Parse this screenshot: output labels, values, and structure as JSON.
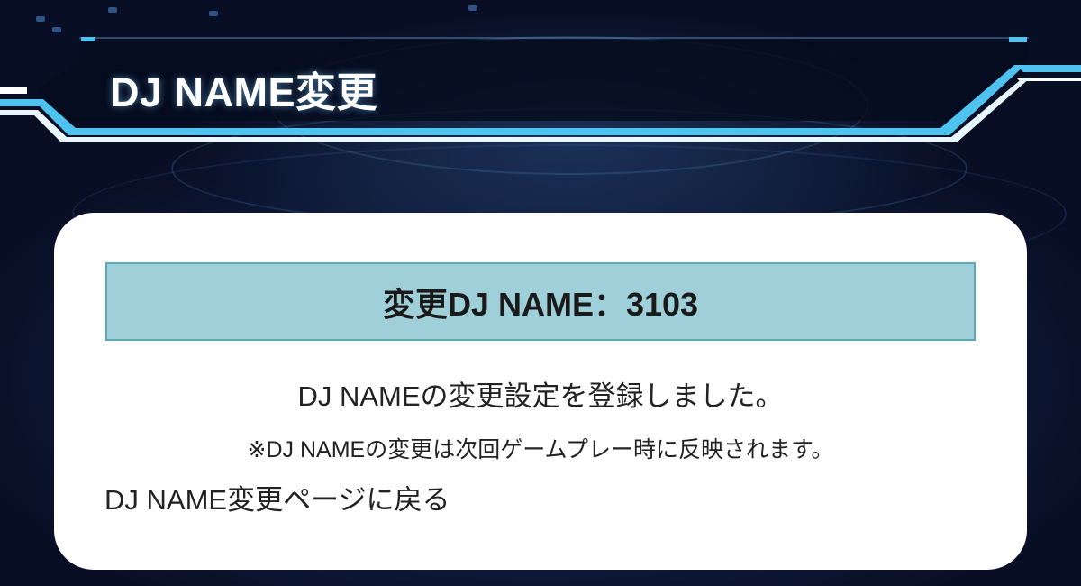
{
  "header": {
    "title": "DJ NAME変更"
  },
  "result": {
    "new_name_label": "変更DJ NAME：3103",
    "message": "DJ NAMEの変更設定を登録しました。",
    "note": "※DJ NAMEの変更は次回ゲームプレー時に反映されます。",
    "back_link": "DJ NAME変更ページに戻る"
  },
  "colors": {
    "background": "#0a1230",
    "accent_cyan": "#4fc3f0",
    "name_box_fill": "#9fd0da",
    "name_box_border": "#5fa9b6",
    "card": "#ffffff"
  }
}
